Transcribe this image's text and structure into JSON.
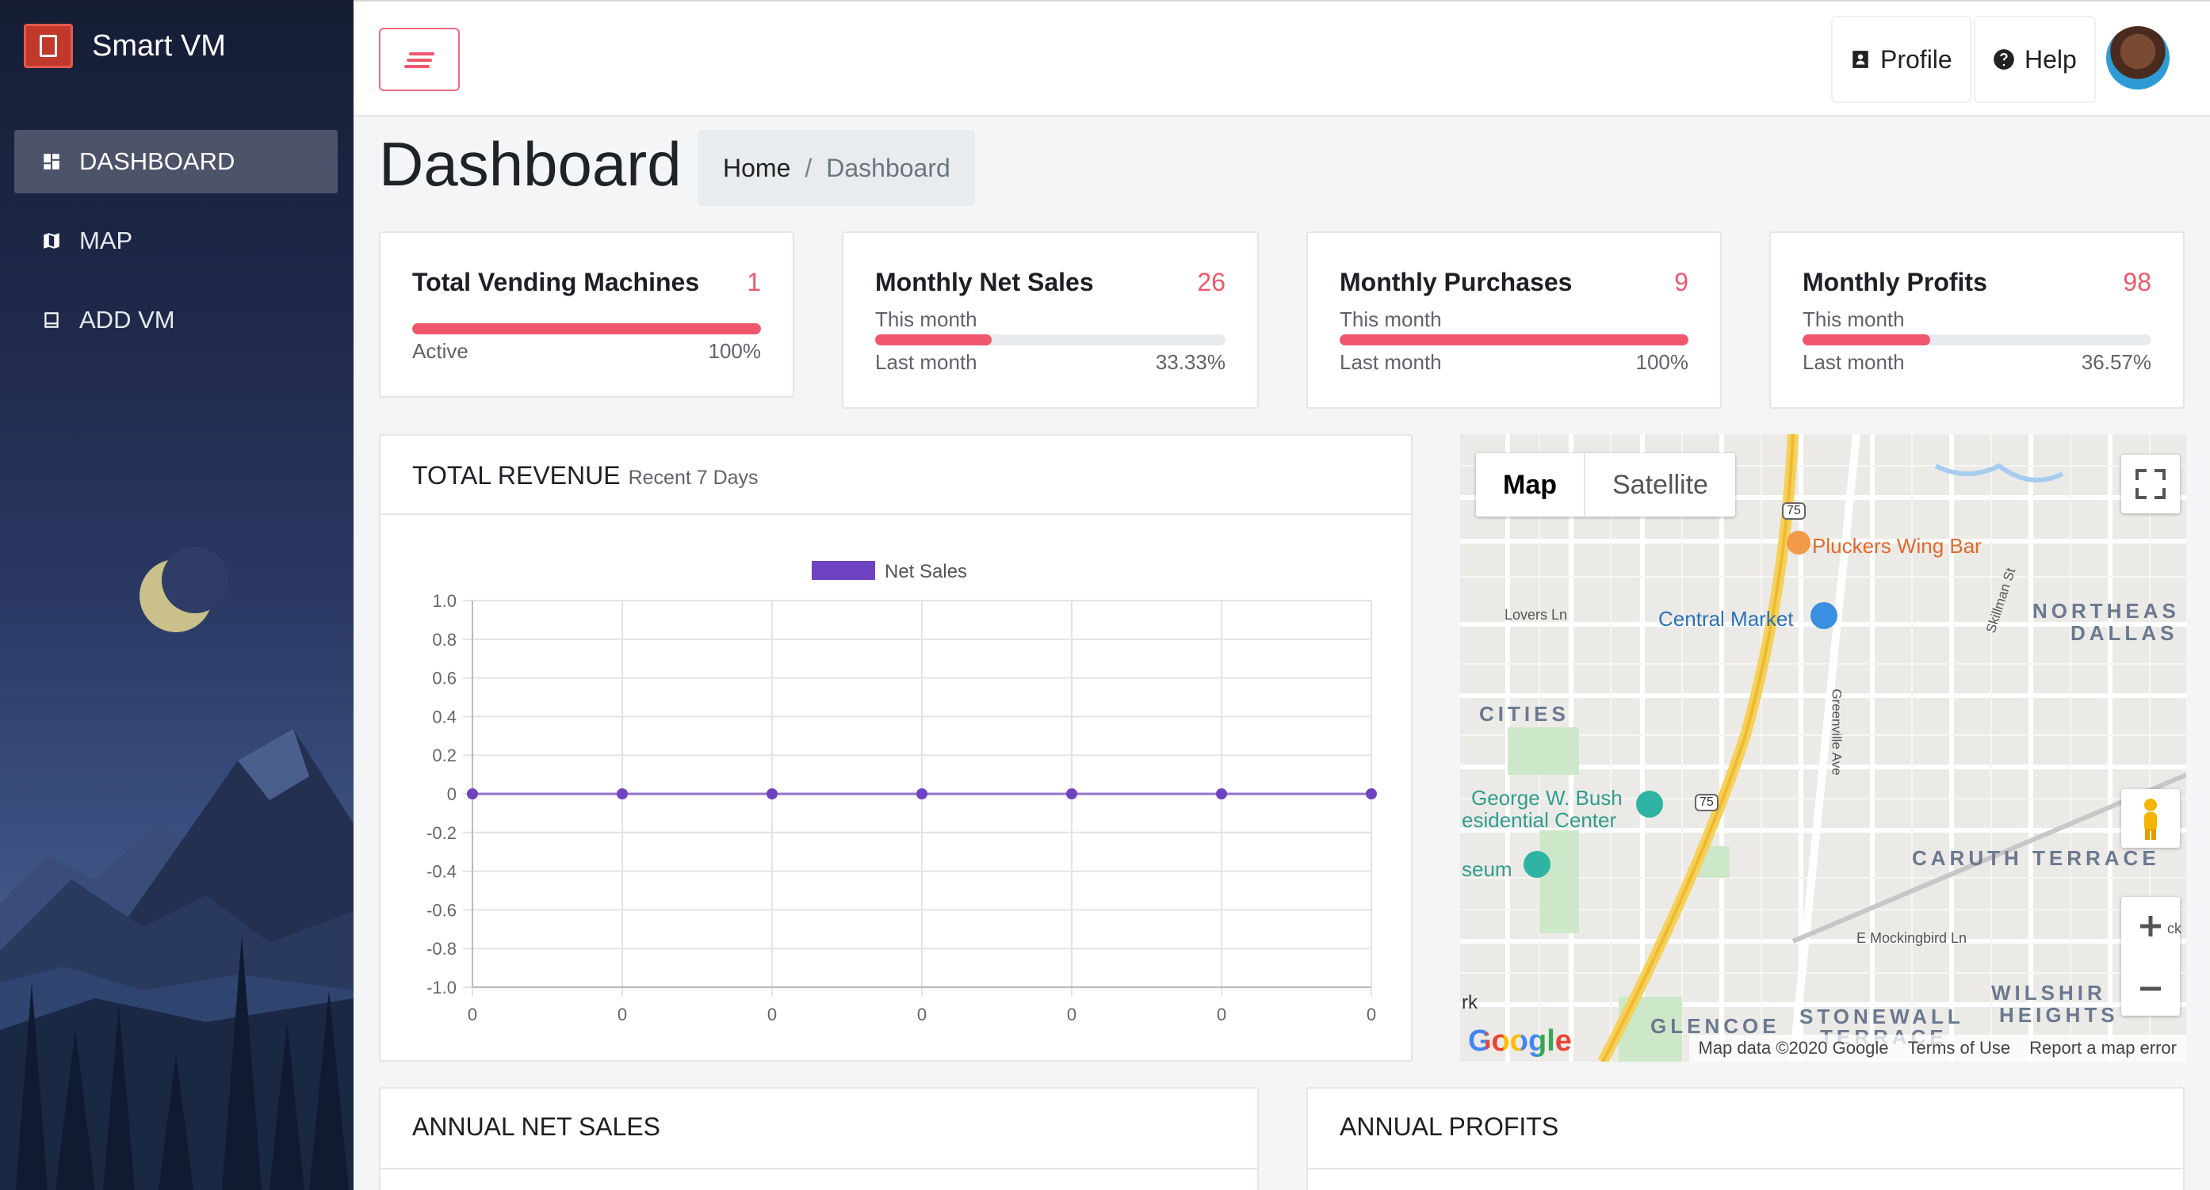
{
  "app": {
    "name": "Smart VM"
  },
  "sidebar": {
    "items": [
      {
        "label": "DASHBOARD",
        "icon": "dashboard-icon",
        "active": true
      },
      {
        "label": "MAP",
        "icon": "map-icon",
        "active": false
      },
      {
        "label": "ADD VM",
        "icon": "add-vm-icon",
        "active": false
      }
    ]
  },
  "header": {
    "profile_label": "Profile",
    "help_label": "Help"
  },
  "page": {
    "title": "Dashboard"
  },
  "breadcrumb": {
    "home": "Home",
    "separator": "/",
    "current": "Dashboard"
  },
  "stats": [
    {
      "title": "Total Vending Machines",
      "value": "1",
      "bar_label": "Active",
      "pct_label": "100%",
      "fill": 1.0
    },
    {
      "title": "Monthly Net Sales",
      "value": "26",
      "sub": "This month",
      "bar_label": "Last month",
      "pct_label": "33.33%",
      "fill": 0.3333
    },
    {
      "title": "Monthly Purchases",
      "value": "9",
      "sub": "This month",
      "bar_label": "Last month",
      "pct_label": "100%",
      "fill": 1.0
    },
    {
      "title": "Monthly Profits",
      "value": "98",
      "sub": "This month",
      "bar_label": "Last month",
      "pct_label": "36.57%",
      "fill": 0.3657
    }
  ],
  "revenue": {
    "title": "TOTAL REVENUE",
    "subtitle": "Recent 7 Days"
  },
  "chart_data": {
    "type": "line",
    "title": "",
    "xlabel": "",
    "ylabel": "",
    "categories": [
      "0",
      "0",
      "0",
      "0",
      "0",
      "0",
      "0"
    ],
    "series": [
      {
        "name": "Net Sales",
        "values": [
          0,
          0,
          0,
          0,
          0,
          0,
          0
        ],
        "color": "#6f42c1"
      }
    ],
    "yticks": [
      "1.0",
      "0.8",
      "0.6",
      "0.4",
      "0.2",
      "0",
      "-0.2",
      "-0.4",
      "-0.6",
      "-0.8",
      "-1.0"
    ],
    "ylim": [
      -1.0,
      1.0
    ],
    "grid": true,
    "legend": "top"
  },
  "map": {
    "toggle_map": "Map",
    "toggle_satellite": "Satellite",
    "labels": {
      "pluckers": "Pluckers Wing Bar",
      "central_market": "Central Market",
      "northeast_dallas_1": "NORTHEAS",
      "northeast_dallas_2": "DALLAS",
      "lovers_ln": "Lovers Ln",
      "skillman": "Skillman St",
      "cities": "CITIES",
      "greenville": "Greenville Ave",
      "bush_1": "George W. Bush",
      "bush_2": "esidential Center",
      "museum": "seum",
      "caruth": "CARUTH TERRACE",
      "mockingbird": "E Mockingbird Ln",
      "glencoe": "GLENCOE",
      "stonewall_1": "STONEWALL",
      "stonewall_2": "TERRACE",
      "wilshire_1": "WILSHIR",
      "wilshire_2": "HEIGHTS",
      "rk": "rk",
      "ck": "ck",
      "hwy": "75"
    },
    "google": "Google",
    "attribution": {
      "data": "Map data ©2020 Google",
      "terms": "Terms of Use",
      "report": "Report a map error"
    }
  },
  "annual": {
    "net_sales_title": "ANNUAL NET SALES",
    "profits_title": "ANNUAL PROFITS"
  },
  "colors": {
    "accent": "#f0576d",
    "series": "#6f42c1",
    "sidebar": "#1e2848"
  }
}
